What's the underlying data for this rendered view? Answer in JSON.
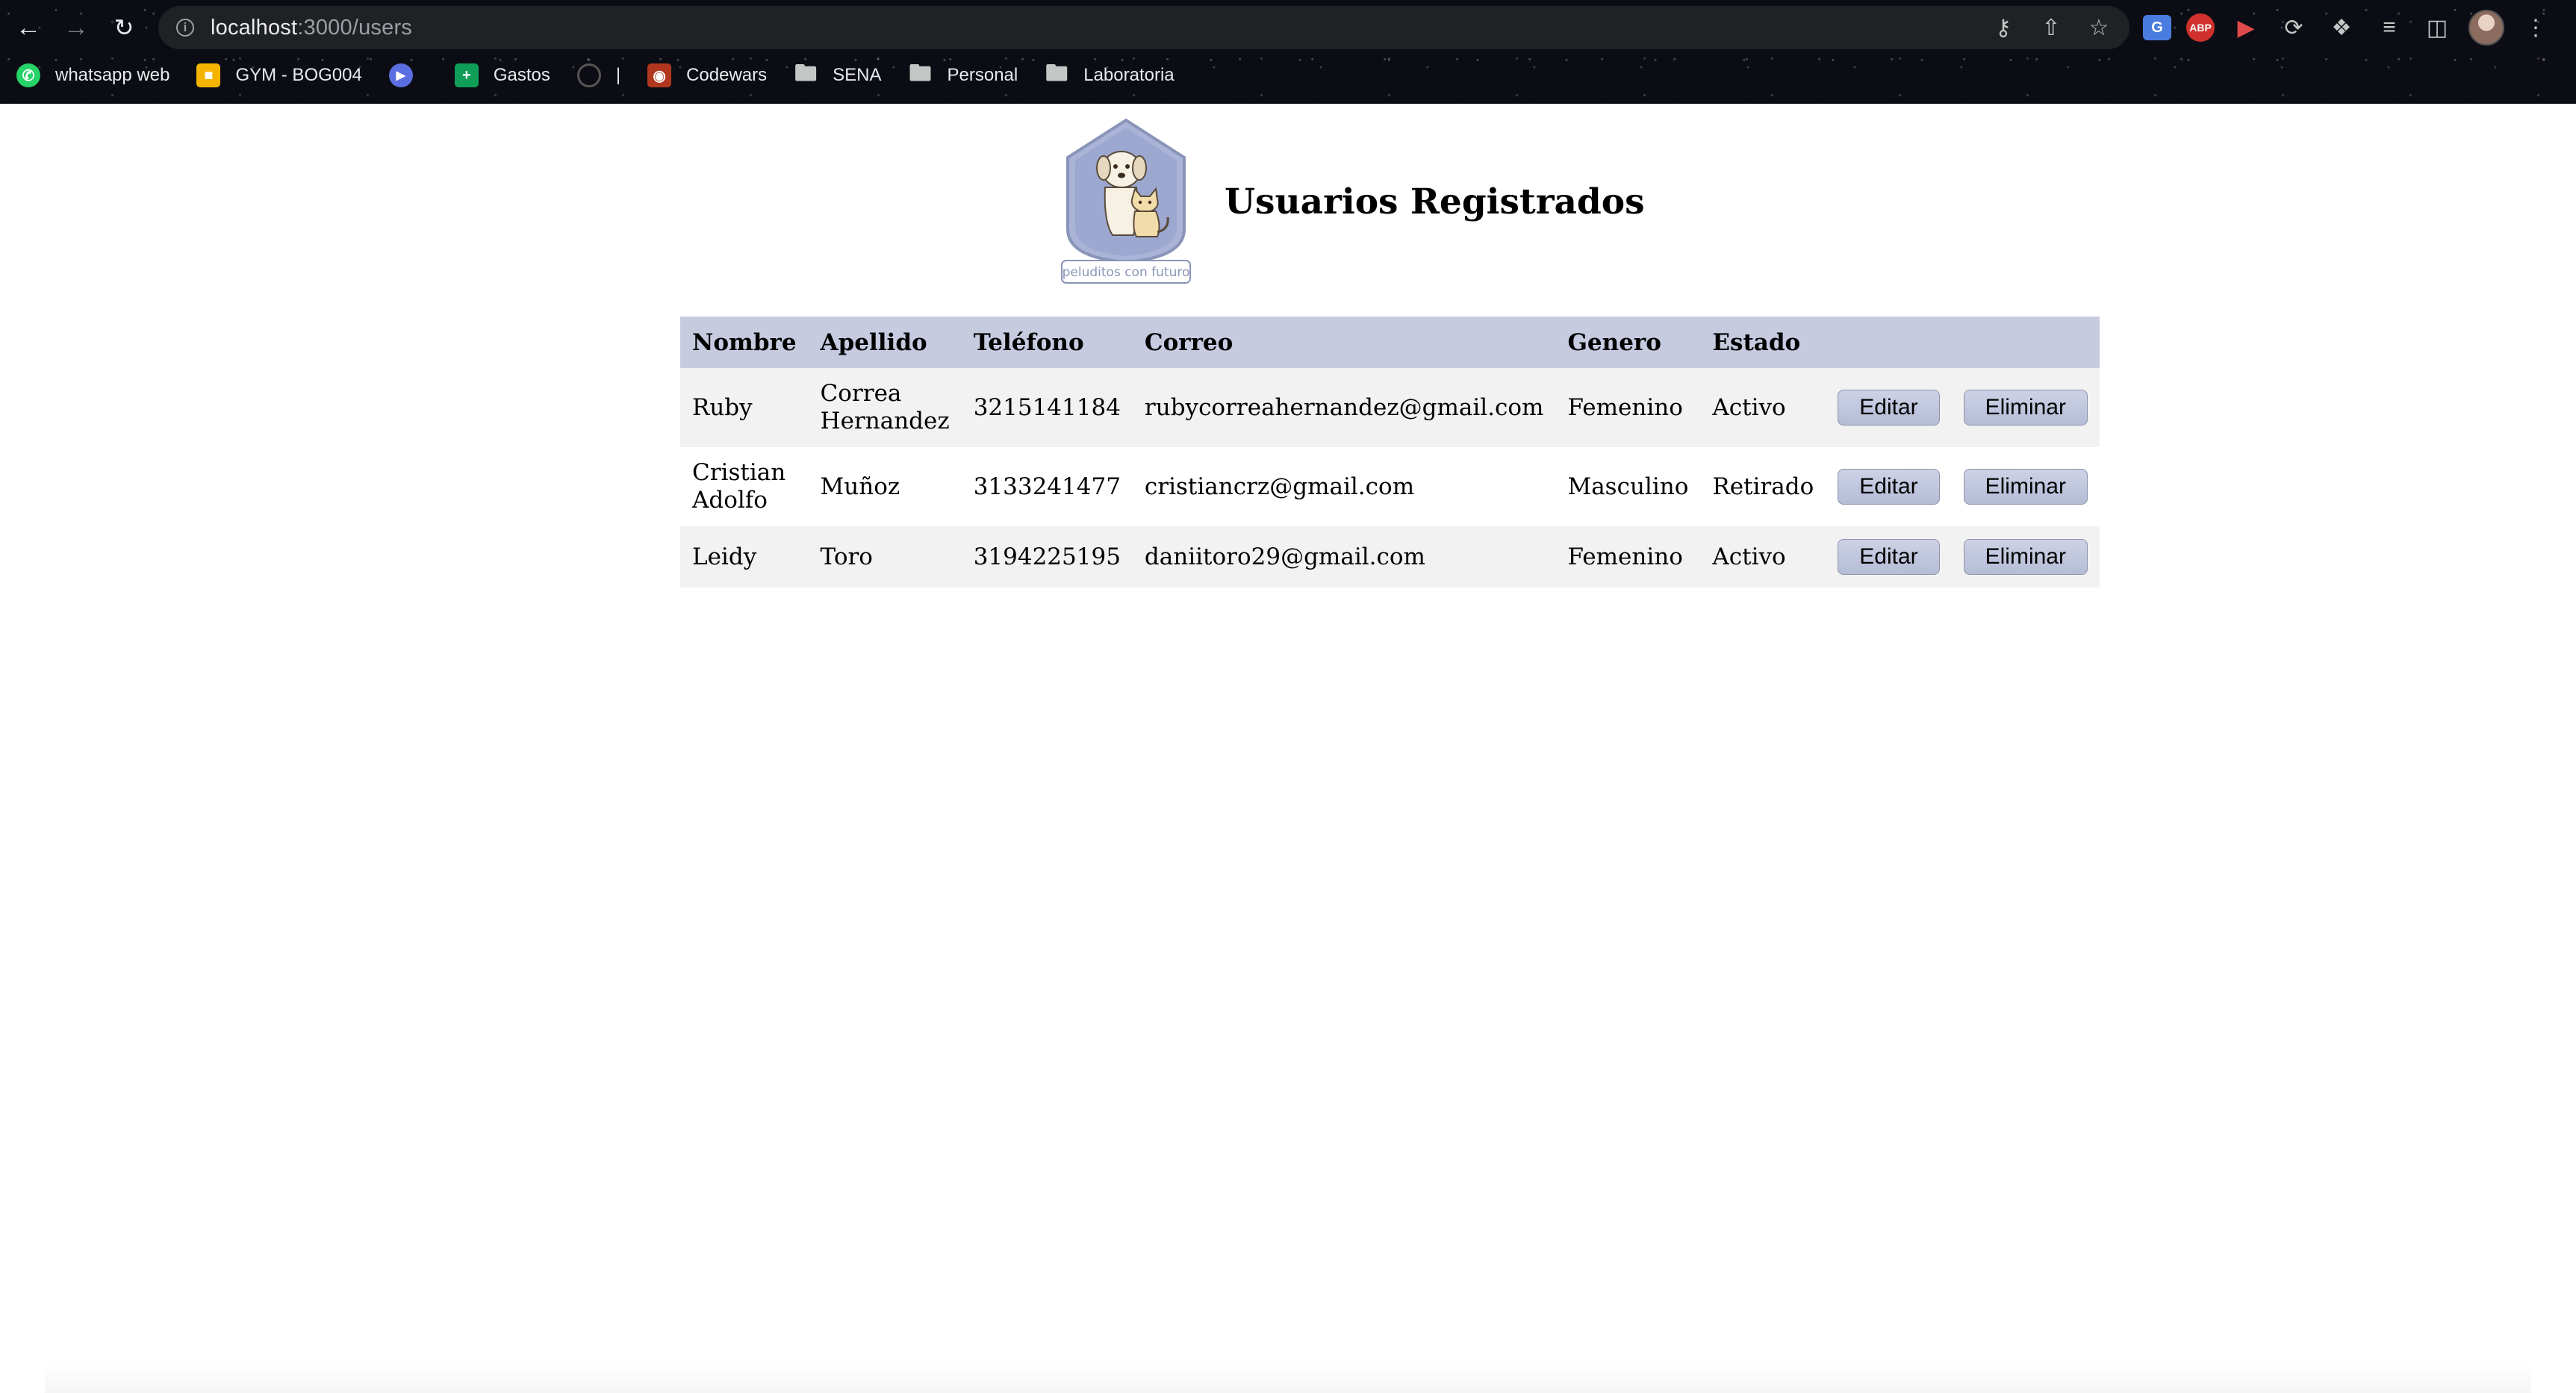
{
  "browser": {
    "url_host": "localhost",
    "url_path": ":3000/users",
    "bookmarks": [
      {
        "label": "whatsapp web",
        "icon": "whatsapp-icon"
      },
      {
        "label": "GYM - BOG004",
        "icon": "gym-icon"
      },
      {
        "label": "",
        "icon": "play-icon"
      },
      {
        "label": "Gastos",
        "icon": "sheets-icon"
      },
      {
        "label": "|",
        "icon": "github-icon"
      },
      {
        "label": "Codewars",
        "icon": "codewars-icon"
      },
      {
        "label": "SENA",
        "icon": "folder-icon"
      },
      {
        "label": "Personal",
        "icon": "folder-icon"
      },
      {
        "label": "Laboratoria",
        "icon": "folder-icon"
      }
    ],
    "extensions": [
      "translate-icon",
      "adblock-icon",
      "record-icon",
      "refresh-icon",
      "puzzle-icon",
      "media-icon",
      "sidepanel-icon",
      "avatar",
      "menu-icon"
    ]
  },
  "page": {
    "title": "Usuarios Registrados",
    "logo_text": "peluditos con futuro",
    "accent_color": "#c6cbe0"
  },
  "table": {
    "headers": [
      "Nombre",
      "Apellido",
      "Teléfono",
      "Correo",
      "Genero",
      "Estado",
      "",
      ""
    ],
    "rows": [
      {
        "nombre": "Ruby",
        "apellido": "Correa Hernandez",
        "telefono": "3215141184",
        "correo": "rubycorreahernandez@gmail.com",
        "genero": "Femenino",
        "estado": "Activo"
      },
      {
        "nombre": "Cristian Adolfo",
        "apellido": "Muñoz",
        "telefono": "3133241477",
        "correo": "cristiancrz@gmail.com",
        "genero": "Masculino",
        "estado": "Retirado"
      },
      {
        "nombre": "Leidy",
        "apellido": "Toro",
        "telefono": "3194225195",
        "correo": "daniitoro29@gmail.com",
        "genero": "Femenino",
        "estado": "Activo"
      }
    ],
    "edit_label": "Editar",
    "delete_label": "Eliminar"
  }
}
